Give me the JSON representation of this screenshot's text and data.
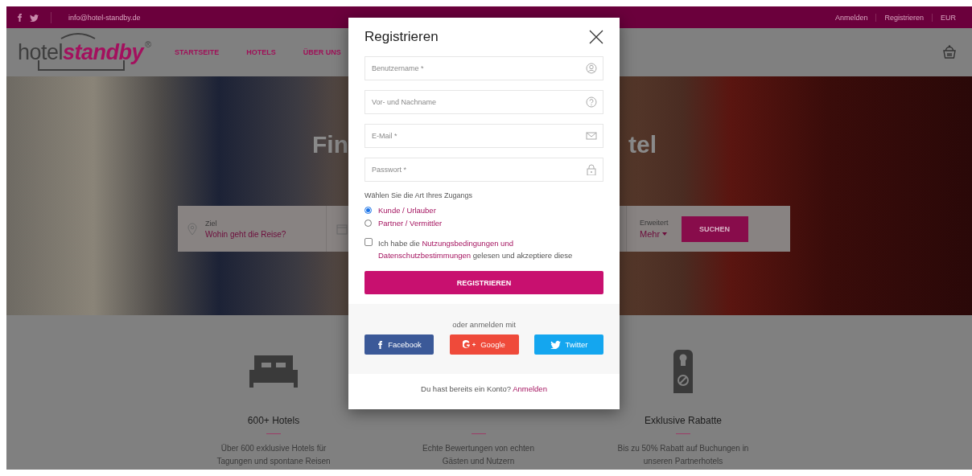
{
  "topbar": {
    "email": "info@hotel-standby.de",
    "links": [
      "Anmelden",
      "Registrieren",
      "EUR"
    ]
  },
  "header": {
    "logo": {
      "light": "hotel",
      "bold": "standby",
      "mark": "®"
    },
    "nav": [
      "STARTSEITE",
      "HOTELS",
      "ÜBER UNS"
    ]
  },
  "hero": {
    "title_left": "Fin",
    "title_right": "tel",
    "search": {
      "destination_label": "Ziel",
      "destination_placeholder": "Wohin geht die Reise?",
      "advanced_label": "Erweitert",
      "advanced_value": "Mehr",
      "button": "SUCHEN"
    }
  },
  "features": [
    {
      "title": "600+ Hotels",
      "text": "Über 600 exklusive Hotels für Tagungen und spontane Reisen"
    },
    {
      "text": "Echte Bewertungen von echten Gästen und Nutzern"
    },
    {
      "title": "Exklusive Rabatte",
      "text": "Bis zu 50% Rabatt auf Buchungen in unseren Partnerhotels"
    }
  ],
  "modal": {
    "title": "Registrieren",
    "fields": [
      {
        "placeholder": "Benutzername *"
      },
      {
        "placeholder": "Vor- und Nachname"
      },
      {
        "placeholder": "E-Mail *"
      },
      {
        "placeholder": "Passwort *"
      }
    ],
    "access_label": "Wählen Sie die Art Ihres Zugangs",
    "access_types": [
      {
        "label": "Kunde / Urlauber",
        "selected": true
      },
      {
        "label": "Partner / Vermittler",
        "selected": false
      }
    ],
    "terms": {
      "checked": false,
      "text": "Ich habe die **Nutzungsbedingungen und Datenschutzbestimmungen** gelesen und akzeptiere diese"
    },
    "submit": "REGISTRIEREN",
    "social_label": "oder anmelden mit",
    "social": [
      {
        "kind": "facebook",
        "label": "Facebook",
        "color": "#3b5998"
      },
      {
        "kind": "google",
        "label": "Google",
        "color": "#ef4a3a"
      },
      {
        "kind": "twitter",
        "label": "Twitter",
        "color": "#14a6ef"
      }
    ],
    "footer_text": "Du hast bereits ein Konto?",
    "footer_link": "Anmelden"
  }
}
